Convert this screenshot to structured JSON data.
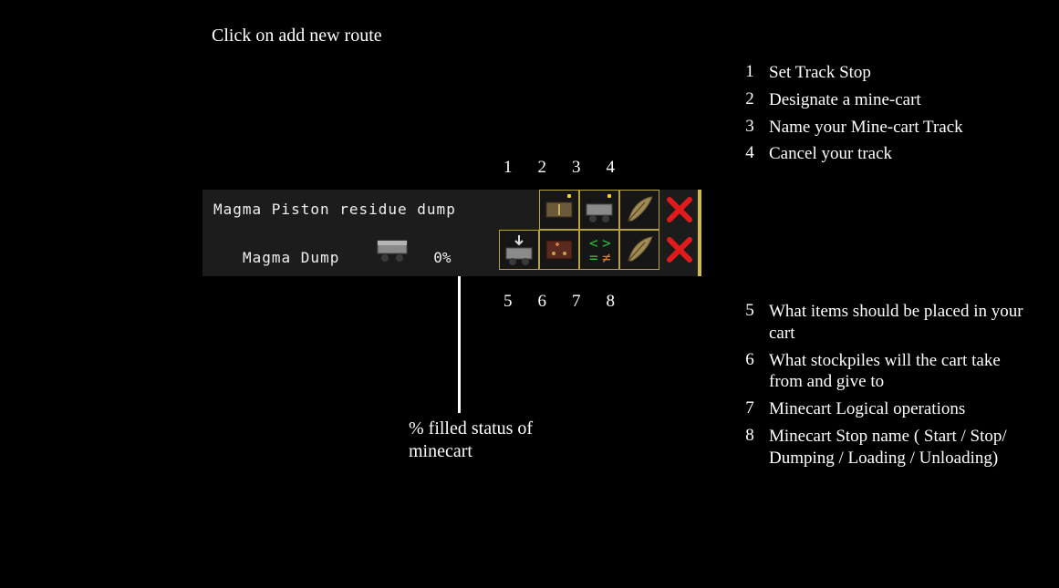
{
  "instruction": "Click on add new route",
  "top_numbers": [
    "1",
    "2",
    "3",
    "4"
  ],
  "bottom_numbers": [
    "5",
    "6",
    "7",
    "8"
  ],
  "legend_top": [
    {
      "num": "1",
      "text": "Set Track Stop"
    },
    {
      "num": "2",
      "text": "Designate a mine-cart"
    },
    {
      "num": "3",
      "text": "Name your Mine-cart Track"
    },
    {
      "num": "4",
      "text": "Cancel your track"
    }
  ],
  "legend_bottom": [
    {
      "num": "5",
      "text": "What items should be placed in your cart"
    },
    {
      "num": "6",
      "text": "What stockpiles will the cart take from and give to"
    },
    {
      "num": "7",
      "text": "Minecart Logical operations"
    },
    {
      "num": "8",
      "text": "Minecart Stop name ( Start / Stop/ Dumping / Loading / Unloading)"
    }
  ],
  "panel": {
    "route_title": "Magma Piston residue dump",
    "stop_name": "Magma Dump",
    "percent": "0%"
  },
  "callout": "% filled status of minecart",
  "colors": {
    "border": "#b8a23a",
    "plus": "#f2d21a",
    "red": "#e11b1b",
    "green": "#2fbf3a"
  }
}
